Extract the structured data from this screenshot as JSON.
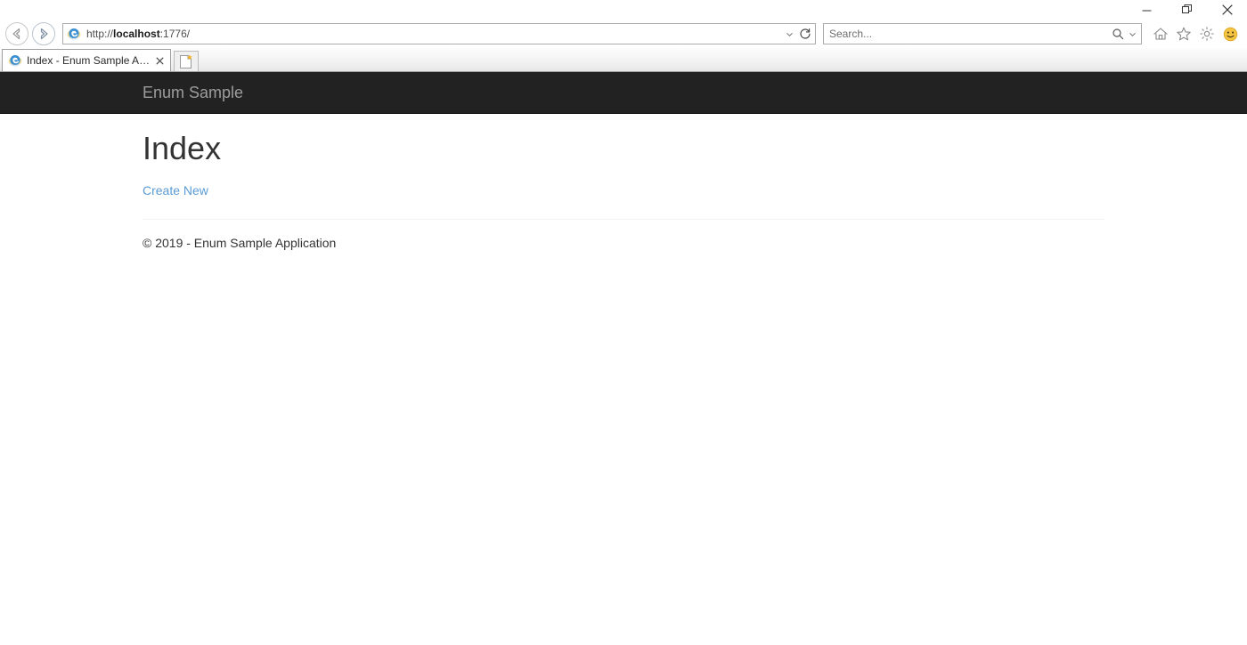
{
  "window": {
    "minimize_label": "Minimize",
    "restore_label": "Restore",
    "close_label": "Close"
  },
  "navigation": {
    "back_label": "Back",
    "forward_label": "Forward",
    "refresh_label": "Refresh",
    "address_dropdown_label": "Address dropdown"
  },
  "address": {
    "protocol": "http://",
    "host": "localhost",
    "rest": ":1776/",
    "full_url": "http://localhost:1776/"
  },
  "search": {
    "placeholder": "Search...",
    "submit_label": "Search",
    "provider_dropdown_label": "Search provider"
  },
  "toolbar": {
    "home_label": "Home",
    "favorites_label": "Favorites",
    "tools_label": "Tools",
    "feedback_label": "Send a smile feedback"
  },
  "tabs": {
    "items": [
      {
        "title": "Index - Enum Sample Appli...",
        "close_label": "Close tab"
      }
    ],
    "new_tab_label": "New tab"
  },
  "site": {
    "brand": "Enum Sample",
    "heading": "Index",
    "create_link": "Create New",
    "footer": "© 2019 - Enum Sample Application"
  },
  "colors": {
    "navbar_bg": "#222222",
    "navbar_brand": "#9d9d9d",
    "link": "#5b9bd5",
    "text": "#333333",
    "hr": "#f2f2f2"
  }
}
